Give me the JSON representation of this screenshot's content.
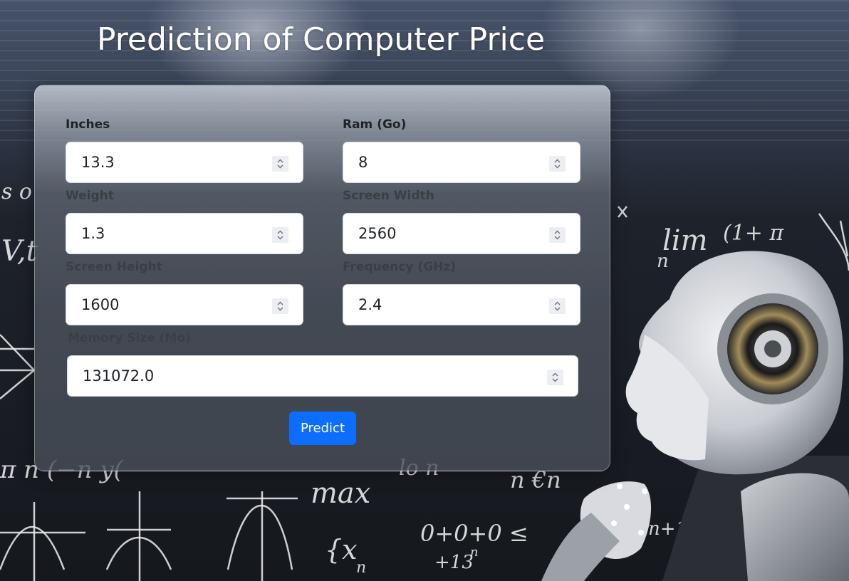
{
  "page": {
    "title": "Prediction of Computer Price"
  },
  "form": {
    "fields": [
      {
        "label": "Inches",
        "value": "13.3"
      },
      {
        "label": "Ram (Go)",
        "value": "8"
      },
      {
        "label": "Weight",
        "value": "1.3"
      },
      {
        "label": "Screen Width",
        "value": "2560"
      },
      {
        "label": "Screen Height",
        "value": "1600"
      },
      {
        "label": "Frequency (GHz)",
        "value": "2.4"
      },
      {
        "label": "Memory Size (Mo)",
        "value": "131072.0"
      }
    ],
    "predict_label": "Predict"
  },
  "background": {
    "chalk": {
      "lim": "lim",
      "max": "max",
      "seq": "0+0+0 ≤",
      "n13": "n+13n",
      "xn": "{x",
      "n_sub": "n",
      "plus13": "+13",
      "n_exp": "n",
      "frac": "(1+ π",
      "n_left": "n",
      "v_left": "V,t",
      "s_left": "s o",
      "lower_left": "π n (−n y(",
      "mid_lower": "lo n",
      "n_brack": "n €n"
    }
  },
  "colors": {
    "accent": "#0d6efd",
    "title_text": "#ffffff",
    "input_bg": "#ffffff"
  }
}
